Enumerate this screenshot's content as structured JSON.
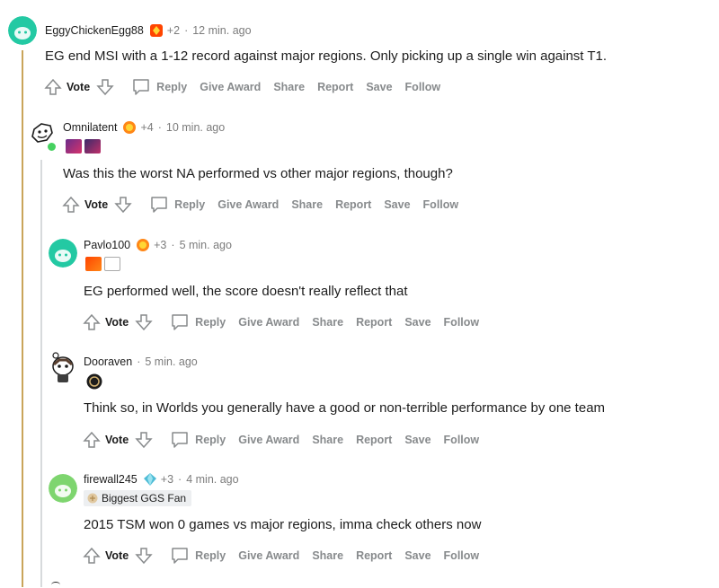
{
  "comments": [
    {
      "author": "EggyChickenEgg88",
      "karma": "+2",
      "time": "12 min. ago",
      "body": "EG end MSI with a 1-12 record against major regions. Only picking up a single win against T1."
    },
    {
      "author": "Omnilatent",
      "karma": "+4",
      "time": "10 min. ago",
      "body": "Was this the worst NA performed vs other major regions, though?"
    },
    {
      "author": "Pavlo100",
      "karma": "+3",
      "time": "5 min. ago",
      "body": "EG performed well, the score doesn't really reflect that"
    },
    {
      "author": "Dooraven",
      "karma": "",
      "time": "5 min. ago",
      "body": "Think so, in Worlds you generally have a good or non-terrible performance by one team"
    },
    {
      "author": "firewall245",
      "karma": "+3",
      "time": "4 min. ago",
      "flair": "Biggest GGS Fan",
      "body": "2015 TSM won 0 games vs major regions, imma check others now"
    }
  ],
  "actions": {
    "vote": "Vote",
    "reply": "Reply",
    "give_award": "Give Award",
    "share": "Share",
    "report": "Report",
    "save": "Save",
    "follow": "Follow"
  },
  "separator": "·",
  "colors": {
    "snoo_teal": "#23c9a3",
    "snoo_green": "#7ed56f",
    "online": "#46d160",
    "thread_gold": "#c9a45a",
    "thread_grey": "#d7dadc"
  }
}
